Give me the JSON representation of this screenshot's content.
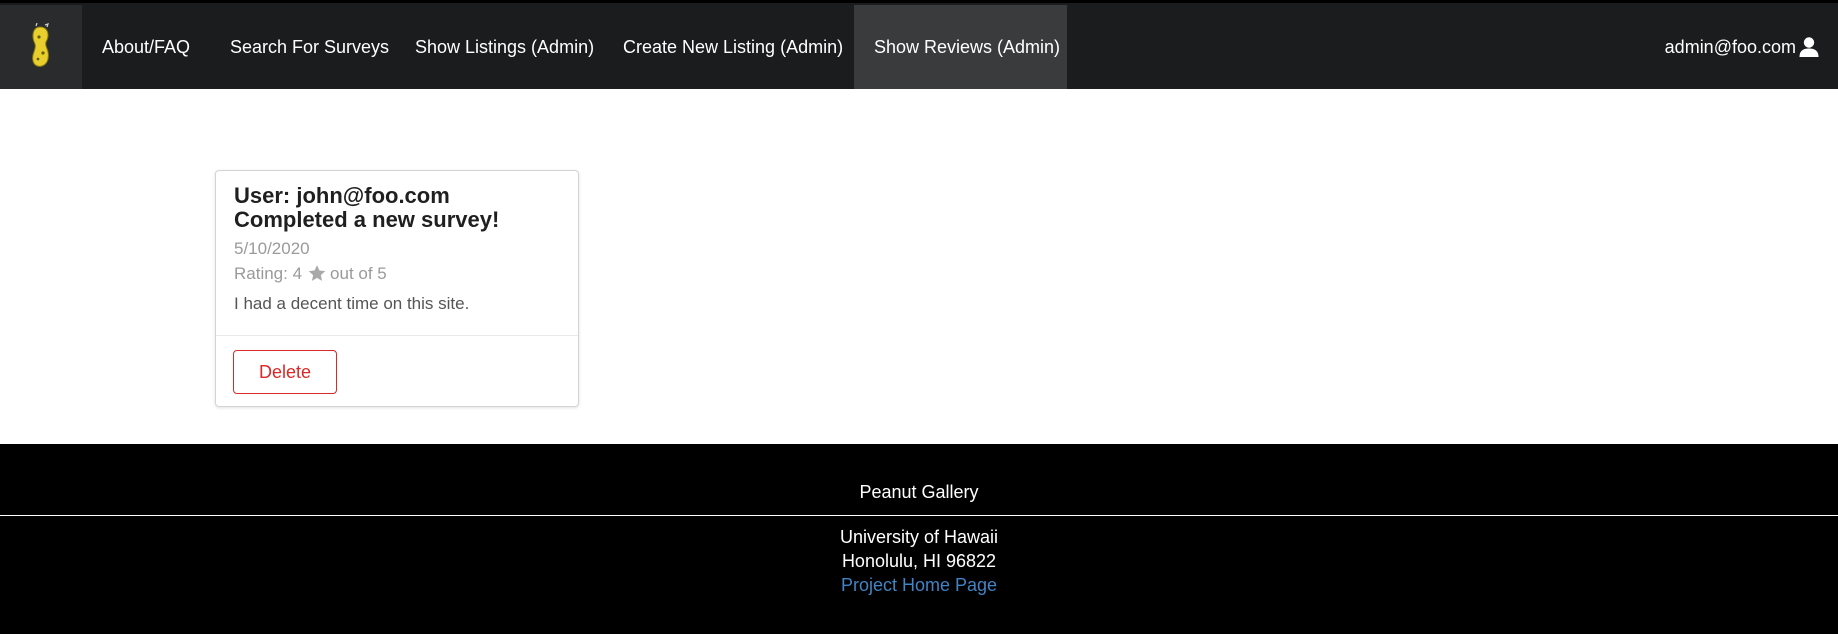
{
  "nav": {
    "logo_icon": "peanut-logo-icon",
    "links": [
      {
        "label": "About/FAQ"
      },
      {
        "label": "Search For Surveys"
      },
      {
        "label": "Show Listings (Admin)"
      },
      {
        "label": "Create New Listing (Admin)"
      },
      {
        "label": "Show Reviews (Admin)",
        "active": true
      }
    ],
    "user": {
      "email": "admin@foo.com",
      "icon": "user-icon"
    }
  },
  "review": {
    "user_line": "User: john@foo.com",
    "title_line": "Completed a new survey!",
    "date": "5/10/2020",
    "rating_prefix": "Rating: 4",
    "rating_icon": "star-icon",
    "rating_suffix": "out of 5",
    "comment": "I had a decent time on this site.",
    "delete_label": "Delete"
  },
  "footer": {
    "brand": "Peanut Gallery",
    "university": "University of Hawaii",
    "address": "Honolulu, HI 96822",
    "link_label": "Project Home Page"
  },
  "colors": {
    "navbar_bg": "#1b1c1d",
    "active_tab_bg": "#3a3b3c",
    "delete_red": "#db2828",
    "footer_bg": "#000000",
    "link_blue": "#4183c4"
  }
}
